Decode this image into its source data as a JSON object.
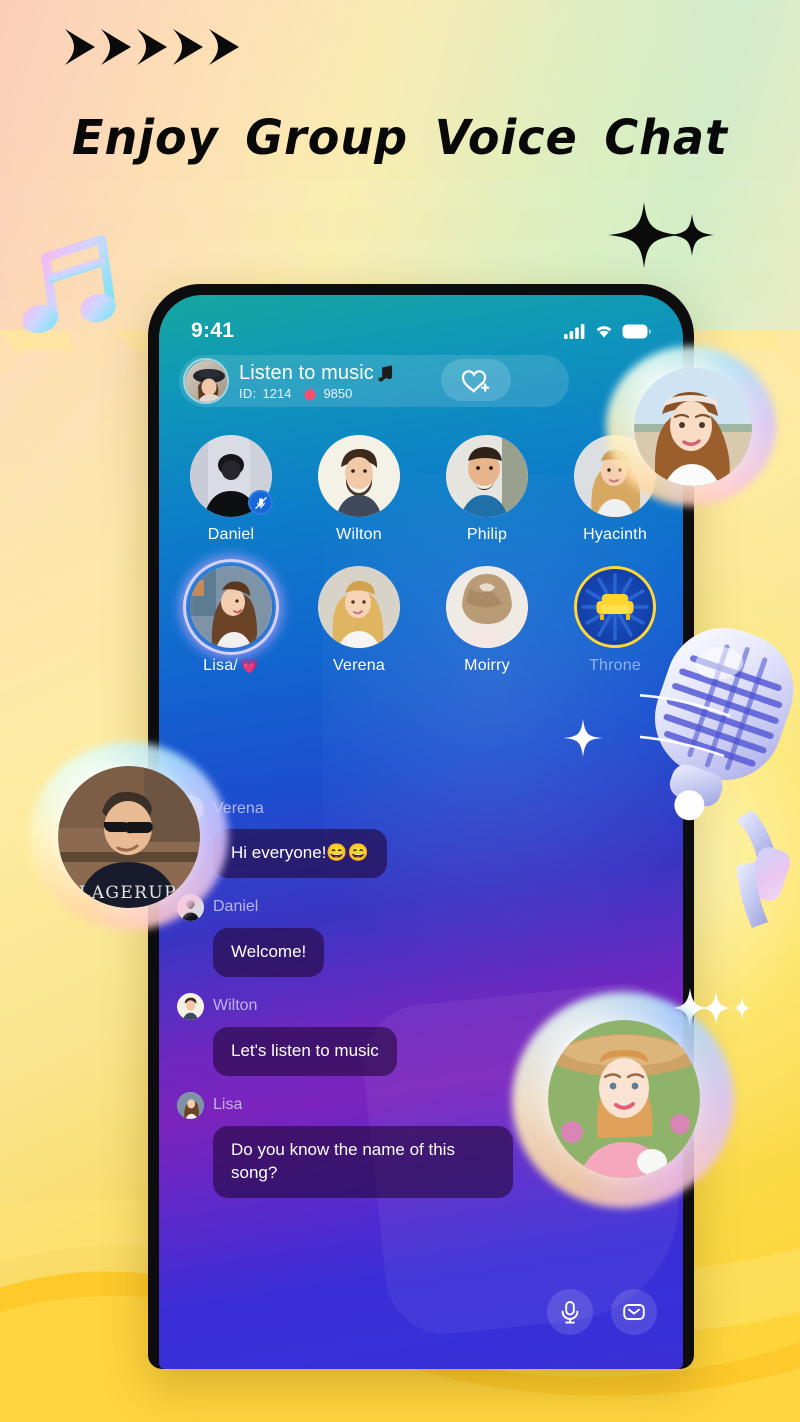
{
  "promo": {
    "headline": "Enjoy Group Voice Chat",
    "arrow_count": 5,
    "arrow_icon": "double-chevron-right-icon",
    "music_note_icon": "music-note-icon",
    "sparkle_icon": "sparkle-icon",
    "background_colors": {
      "peach": "#fbd3c0",
      "mint": "#cdeecd",
      "yellow": "#fed233",
      "gold": "#f9c41f"
    }
  },
  "phone": {
    "statusbar": {
      "time": "9:41",
      "signal_icon": "cellular-signal-icon",
      "wifi_icon": "wifi-icon",
      "battery_icon": "battery-full-icon"
    },
    "room_header": {
      "avatar": "host-avatar",
      "title": "Listen to music",
      "title_icon": "music-note-icon",
      "id_label": "ID:",
      "id_value": "1214",
      "heat_icon": "fire-icon",
      "heat_value": "9850",
      "follow_button_icon": "heart-plus-icon",
      "follow_button_label": "Follow"
    },
    "seats": [
      [
        {
          "name": "Daniel",
          "avatar": "avatar-daniel",
          "muted": true,
          "speaking": false,
          "type": "user"
        },
        {
          "name": "Wilton",
          "avatar": "avatar-wilton",
          "muted": false,
          "speaking": false,
          "type": "user"
        },
        {
          "name": "Philip",
          "avatar": "avatar-philip",
          "muted": false,
          "speaking": false,
          "type": "user"
        },
        {
          "name": "Hyacinth",
          "avatar": "avatar-hyacinth",
          "muted": false,
          "speaking": false,
          "type": "user"
        }
      ],
      [
        {
          "name": "Lisa/",
          "name_emoji": "💗",
          "avatar": "avatar-lisa",
          "muted": false,
          "speaking": true,
          "type": "user"
        },
        {
          "name": "Verena",
          "avatar": "avatar-verena",
          "muted": false,
          "speaking": false,
          "type": "user"
        },
        {
          "name": "Moirry",
          "avatar": "avatar-moirry",
          "muted": false,
          "speaking": false,
          "type": "user"
        },
        {
          "name": "Throne",
          "avatar": "throne-chair-icon",
          "muted": false,
          "speaking": false,
          "type": "throne",
          "dim": true
        }
      ]
    ],
    "chat": [
      {
        "sender": "Verena",
        "avatar": "avatar-verena",
        "text": "Hi everyone!😄😄"
      },
      {
        "sender": "Daniel",
        "avatar": "avatar-daniel",
        "text": "Welcome!"
      },
      {
        "sender": "Wilton",
        "avatar": "avatar-wilton",
        "text": "Let's listen to music"
      },
      {
        "sender": "Lisa",
        "avatar": "avatar-lisa",
        "text": "Do you know the name of this song?"
      }
    ],
    "bottom_bar": [
      {
        "name": "microphone-button",
        "icon": "microphone-icon"
      },
      {
        "name": "message-button",
        "icon": "envelope-icon"
      }
    ],
    "screen_colors": {
      "top": "#16a79f",
      "mid": "#1b4fd0",
      "bottom": "#6e28c0"
    }
  },
  "floating_bubbles": [
    {
      "name": "bubble-top-right",
      "photo": "portrait-short-hair-headband"
    },
    {
      "name": "bubble-left",
      "photo": "portrait-man-sunglasses"
    },
    {
      "name": "bubble-bottom-right",
      "photo": "portrait-straw-hat"
    }
  ],
  "illustrations": [
    {
      "name": "retro-microphone-illustration"
    }
  ]
}
